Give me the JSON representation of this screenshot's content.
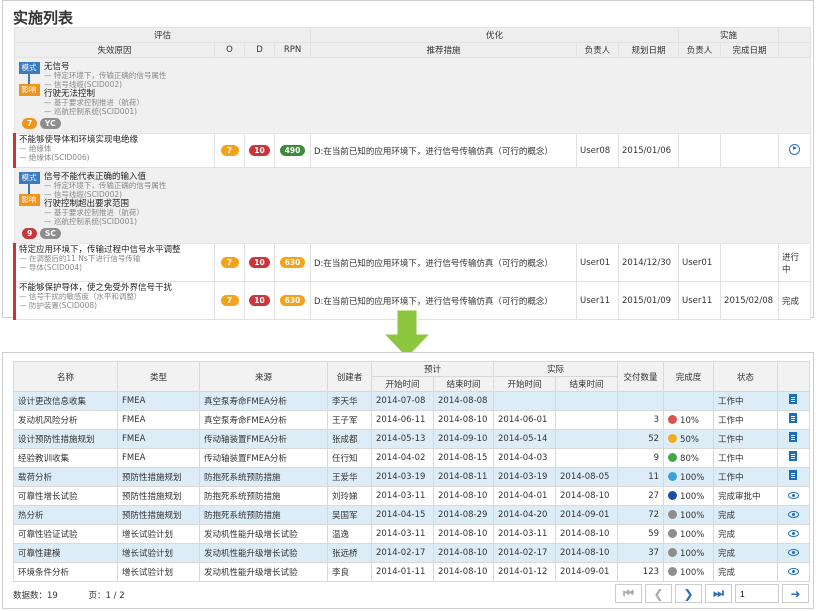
{
  "top": {
    "title": "实施列表",
    "headers": {
      "evaluate": "评估",
      "optimize": "优化",
      "implement": "实施",
      "cause": "失效原因",
      "o": "O",
      "d": "D",
      "rpn": "RPN",
      "measure": "推荐措施",
      "owner": "负责人",
      "plan_date": "规划日期",
      "impl_owner": "负责人",
      "done_date": "完成日期"
    },
    "groups": [
      {
        "mode_tag": "模式",
        "mode_title": "无信号",
        "mode_subs": [
          "— 特定环境下，传输正确的信号属性",
          "— 信号线缆(SCID002)"
        ],
        "effect_tag": "影响",
        "effect_title": "行驶无法控制",
        "effect_subs": [
          "— 基于要求控制推进（航荷）",
          "— 巡航控制系统(SCID001)"
        ],
        "badge_num": "7",
        "badge_code": "YC",
        "row": {
          "cause": "不能够使导体和环境实现电绝缘",
          "cause_subs": [
            "— 绝缘体",
            "— 绝缘体(SCID006)"
          ],
          "o": "7",
          "d": "10",
          "rpn": "490",
          "measure": "D:在当前已知的应用环境下，进行信号传输仿真（可行的概念）",
          "owner": "User08",
          "plan_date": "2015/01/06",
          "impl_owner": "",
          "done_date": "",
          "status": ""
        }
      },
      {
        "mode_tag": "模式",
        "mode_title": "信号不能代表正确的输入值",
        "mode_subs": [
          "— 特定环境下，传输正确的信号属性",
          "— 信号线缆(SCID002)"
        ],
        "effect_tag": "影响",
        "effect_title": "行驶控制超出要求范围",
        "effect_subs": [
          "— 基于要求控制推进（航荷）",
          "— 巡航控制系统(SCID001)"
        ],
        "badge_num": "9",
        "badge_code": "SC",
        "rows": [
          {
            "cause": "特定应用环境下，传输过程中信号水平调整",
            "cause_subs": [
              "— 在调整后的11 Ns下进行信号传输",
              "— 导体(SCID004)"
            ],
            "o": "7",
            "d": "10",
            "rpn": "630",
            "measure": "D:在当前已知的应用环境下，进行信号传输仿真（可行的概念）",
            "owner": "User01",
            "plan_date": "2014/12/30",
            "impl_owner": "User01",
            "done_date": "",
            "status": "进行中"
          },
          {
            "cause": "不能够保护导体，使之免受外界信号干扰",
            "cause_subs": [
              "— 信号干扰的敏感度（水平和调整）",
              "— 防护装置(SCID008)"
            ],
            "o": "7",
            "d": "10",
            "rpn": "630",
            "measure": "D:在当前已知的应用环境下，进行信号传输仿真（可行的概念）",
            "owner": "User11",
            "plan_date": "2015/01/09",
            "impl_owner": "User11",
            "done_date": "2015/02/08",
            "status": "完成"
          }
        ]
      }
    ]
  },
  "bottom": {
    "headers": {
      "name": "名称",
      "type": "类型",
      "source": "来源",
      "creator": "创建者",
      "planned": "预计",
      "actual": "实际",
      "start": "开始时间",
      "end": "结束时间",
      "a_start": "开始时间",
      "a_end": "结束时间",
      "deliverables": "交付数量",
      "completion": "完成度",
      "status": "状态"
    },
    "rows": [
      {
        "name": "设计更改信息收集",
        "type": "FMEA",
        "source": "真空泵寿命FMEA分析",
        "creator": "李天华",
        "start": "2014-07-08",
        "end": "2014-08-08",
        "a_start": "",
        "a_end": "",
        "count": "",
        "pct": "",
        "dot": "",
        "status": "工作中",
        "action": "doc-icon"
      },
      {
        "name": "发动机风险分析",
        "type": "FMEA",
        "source": "真空泵寿命FMEA分析",
        "creator": "王子军",
        "start": "2014-06-11",
        "end": "2014-08-10",
        "a_start": "2014-06-01",
        "a_end": "",
        "count": "3",
        "pct": "10%",
        "dot": "#d9534f",
        "status": "工作中",
        "action": "doc-icon"
      },
      {
        "name": "设计预防性措施规划",
        "type": "FMEA",
        "source": "传动轴装置FMEA分析",
        "creator": "张成都",
        "start": "2014-05-13",
        "end": "2014-09-10",
        "a_start": "2014-05-14",
        "a_end": "",
        "count": "52",
        "pct": "50%",
        "dot": "#f0ad1e",
        "status": "工作中",
        "action": "doc-icon"
      },
      {
        "name": "经验教训收集",
        "type": "FMEA",
        "source": "传动轴装置FMEA分析",
        "creator": "任行知",
        "start": "2014-04-02",
        "end": "2014-08-15",
        "a_start": "2014-04-03",
        "a_end": "",
        "count": "9",
        "pct": "80%",
        "dot": "#43a843",
        "status": "工作中",
        "action": "doc-icon"
      },
      {
        "name": "载荷分析",
        "type": "预防性措施规划",
        "source": "防抱死系统预防措施",
        "creator": "王爱华",
        "start": "2014-03-19",
        "end": "2014-08-11",
        "a_start": "2014-03-19",
        "a_end": "2014-08-05",
        "count": "11",
        "pct": "100%",
        "dot": "#3aa0d8",
        "status": "工作中",
        "action": "doc-icon"
      },
      {
        "name": "可靠性增长试验",
        "type": "预防性措施规划",
        "source": "防抱死系统预防措施",
        "creator": "刘玲娣",
        "start": "2014-03-11",
        "end": "2014-08-10",
        "a_start": "2014-04-01",
        "a_end": "2014-08-10",
        "count": "27",
        "pct": "100%",
        "dot": "#1b4fa0",
        "status": "完成审批中",
        "action": "eye-icon"
      },
      {
        "name": "热分析",
        "type": "预防性措施规划",
        "source": "防抱死系统预防措施",
        "creator": "吴国军",
        "start": "2014-04-15",
        "end": "2014-08-29",
        "a_start": "2014-04-20",
        "a_end": "2014-09-01",
        "count": "72",
        "pct": "100%",
        "dot": "#8e8e8e",
        "status": "完成",
        "action": "eye-icon"
      },
      {
        "name": "可靠性验证试验",
        "type": "增长试验计划",
        "source": "发动机性能升级增长试验",
        "creator": "温逸",
        "start": "2014-03-11",
        "end": "2014-08-10",
        "a_start": "2014-03-11",
        "a_end": "2014-08-10",
        "count": "59",
        "pct": "100%",
        "dot": "#8e8e8e",
        "status": "完成",
        "action": "eye-icon"
      },
      {
        "name": "可靠性建模",
        "type": "增长试验计划",
        "source": "发动机性能升级增长试验",
        "creator": "张远桥",
        "start": "2014-02-17",
        "end": "2014-08-10",
        "a_start": "2014-02-17",
        "a_end": "2014-08-10",
        "count": "37",
        "pct": "100%",
        "dot": "#8e8e8e",
        "status": "完成",
        "action": "eye-icon"
      },
      {
        "name": "环境条件分析",
        "type": "增长试验计划",
        "source": "发动机性能升级增长试验",
        "creator": "李良",
        "start": "2014-01-11",
        "end": "2014-08-10",
        "a_start": "2014-01-12",
        "a_end": "2014-09-01",
        "count": "123",
        "pct": "100%",
        "dot": "#8e8e8e",
        "status": "完成",
        "action": "eye-icon"
      }
    ],
    "footer": {
      "record_count": "数据数：19",
      "page": "页：1 / 2",
      "page_input": "1"
    }
  }
}
